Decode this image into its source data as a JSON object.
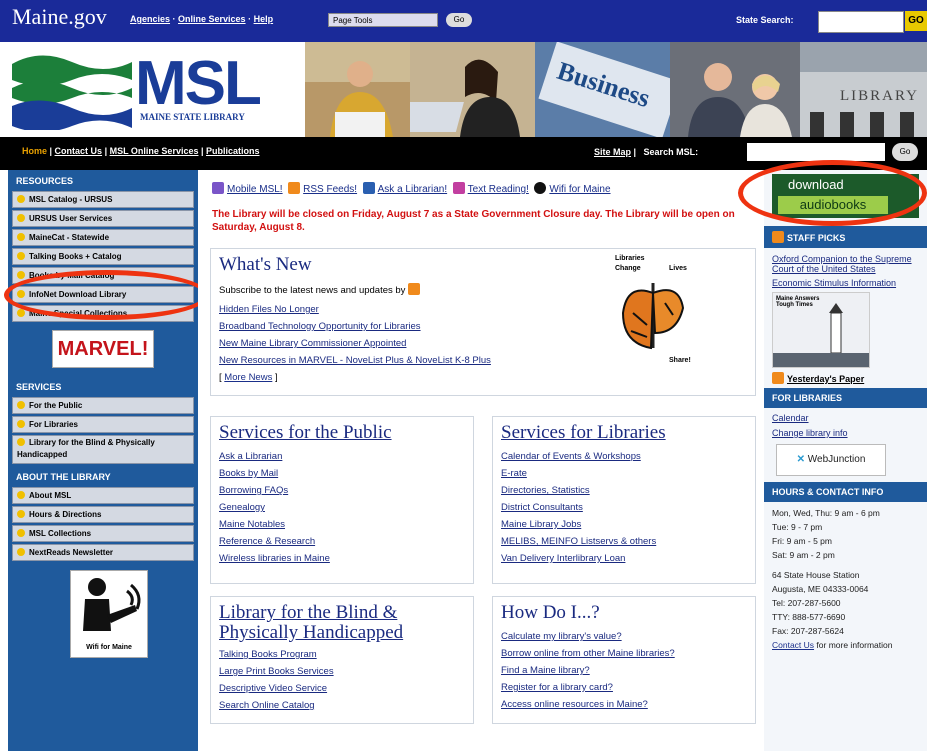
{
  "topbar": {
    "site": "Maine.gov",
    "links": [
      "Agencies",
      "Online Services",
      "Help"
    ],
    "page_tools": "Page Tools",
    "go": "Go",
    "state_search": "State Search:",
    "search_go": "GO"
  },
  "banner": {
    "logo": "MSL",
    "logo_sub": "MAINE STATE LIBRARY",
    "colors": {
      "blue": "#1a3d98",
      "green": "#1c7f3a"
    }
  },
  "nav": {
    "home": "Home",
    "items": [
      "Contact Us",
      "MSL Online Services",
      "Publications"
    ],
    "site_map": "Site Map",
    "search_label": "Search MSL:",
    "go": "Go"
  },
  "left": {
    "resources_title": "RESOURCES",
    "resources": [
      "MSL Catalog - URSUS",
      "URSUS User Services",
      "MaineCat - Statewide",
      "Talking Books + Catalog",
      "Books by Mail Catalog",
      "InfoNet Download Library",
      "Maine Special Collections"
    ],
    "marvel": "MARVEL!",
    "services_title": "SERVICES",
    "services": [
      "For the Public",
      "For Libraries",
      "Library for the Blind & Physically Handicapped"
    ],
    "about_title": "ABOUT THE LIBRARY",
    "about": [
      "About MSL",
      "Hours & Directions",
      "MSL Collections",
      "NextReads Newsletter"
    ],
    "w4m_caption": "Wifi for Maine"
  },
  "center": {
    "quick_links": [
      "Mobile MSL!",
      "RSS Feeds!",
      "Ask a Librarian!",
      "Text Reading!",
      "Wifi for Maine"
    ],
    "closure": "The Library will be closed on Friday, August 7 as a State Government Closure day. The Library will be open on Saturday, August 8.",
    "whats_new": {
      "title": "What's New",
      "subscribe": "Subscribe to the latest news and updates by",
      "items": [
        "Hidden Files No Longer",
        "Broadband Technology Opportunity for Libraries",
        "New Maine Library Commissioner Appointed",
        "New Resources in MARVEL - NoveList Plus & NoveList K-8 Plus"
      ],
      "more": "More News",
      "graphic_text": [
        "Libraries",
        "Change",
        "Lives",
        "Share!"
      ]
    },
    "public": {
      "title": "Services for the Public",
      "items": [
        "Ask a Librarian",
        "Books by Mail",
        "Borrowing FAQs",
        "Genealogy",
        "Maine Notables",
        "Reference & Research",
        "Wireless libraries in Maine"
      ]
    },
    "libraries": {
      "title": "Services for Libraries",
      "items": [
        "Calendar of Events & Workshops",
        "E-rate",
        "Directories, Statistics",
        "District Consultants",
        "Maine Library Jobs",
        "MELIBS, MEINFO Listservs & others",
        "Van Delivery Interlibrary Loan"
      ]
    },
    "blind": {
      "title": "Library for the Blind & Physically Handicapped",
      "items": [
        "Talking Books Program",
        "Large Print Books Services",
        "Descriptive Video Service",
        "Search Online Catalog"
      ]
    },
    "howdoi": {
      "title": "How Do I...?",
      "items": [
        "Calculate my library's value?",
        "Borrow online from other Maine libraries?",
        "Find a Maine library?",
        "Register for a library card?",
        "Access online resources in Maine?"
      ]
    }
  },
  "right": {
    "download": "download",
    "audiobooks": "audiobooks",
    "staff_picks": "STAFF PICKS",
    "picks": [
      "Oxford Companion to the Supreme Court of the United States",
      "Economic Stimulus Information"
    ],
    "maine_answers": "Maine Answers Tough Times",
    "yesterday": "Yesterday's Paper",
    "for_libraries": "FOR LIBRARIES",
    "fl_links": [
      "Calendar",
      "Change library info"
    ],
    "webjunction": "WebJunction",
    "hours_title": "HOURS & CONTACT INFO",
    "hours": [
      "Mon, Wed, Thu: 9 am - 6 pm",
      "Tue: 9 - 7 pm",
      "Fri: 9 am - 5 pm",
      "Sat: 9 am - 2 pm"
    ],
    "address": [
      "64 State House Station",
      "Augusta, ME 04333-0064",
      "Tel: 207-287-5600",
      "TTY: 888-577-6690",
      "Fax: 207-287-5624"
    ],
    "contact_link": "Contact Us",
    "contact_more": "for more information"
  }
}
